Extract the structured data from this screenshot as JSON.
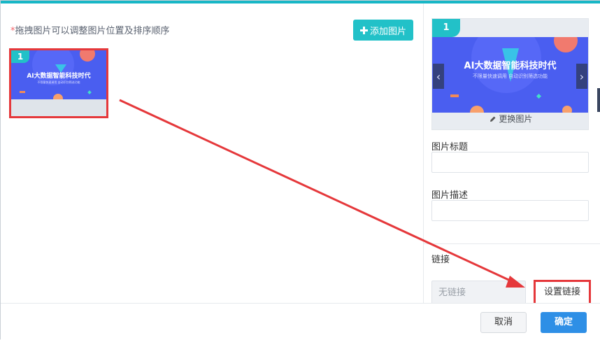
{
  "left": {
    "hint_star": "*",
    "hint_text": "拖拽图片可以调整图片位置及排序顺序",
    "add_button_label": "添加图片",
    "add_icon": "plus-icon",
    "thumb_index": "1"
  },
  "banner": {
    "title": "AI大数据智能科技时代",
    "subtitle": "不限量快速调用    自动识别筛选功能"
  },
  "preview": {
    "index": "1",
    "prev_icon": "‹",
    "next_icon": "›",
    "change_label": "更换图片",
    "change_icon": "pencil-icon"
  },
  "form": {
    "title_label": "图片标题",
    "title_value": "",
    "desc_label": "图片描述",
    "desc_value": "",
    "link_label": "链接",
    "link_value": "无链接",
    "set_link_label": "设置链接"
  },
  "footer": {
    "cancel_label": "取消",
    "ok_label": "确定"
  },
  "colors": {
    "accent": "#22c1c8",
    "primary": "#2e8fe6",
    "annotation": "#e5383b",
    "banner_bg": "#4a5ef0"
  }
}
